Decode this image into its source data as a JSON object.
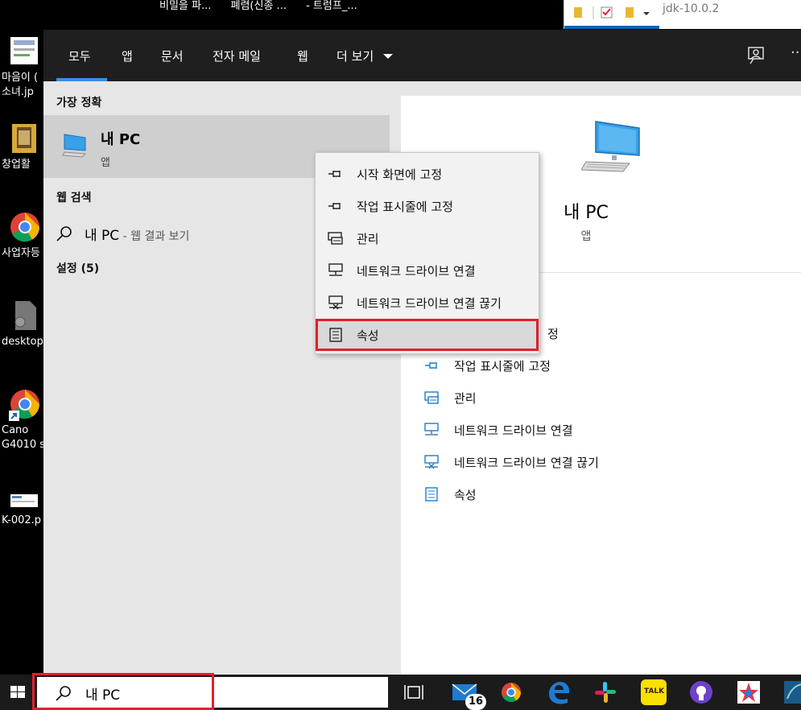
{
  "desktop": {
    "window_titles": [
      "비밀을 파...",
      "폐렴(신종 ...",
      "- 트럼프_..."
    ],
    "explorer_path": "jdk-10.0.2",
    "icons": [
      {
        "label_line1": "마음이 (",
        "label_line2": "소녀.jp"
      },
      {
        "label_line1": "창업활"
      },
      {
        "label_line1": "사업자등"
      },
      {
        "label_line1": "desktop"
      },
      {
        "label_line1": "Cano",
        "label_line2": "G4010 s"
      },
      {
        "label_line1": "K-002.p"
      }
    ]
  },
  "tabs": [
    "모두",
    "앱",
    "문서",
    "전자 메일",
    "웹",
    "더 보기"
  ],
  "left": {
    "best_match_header": "가장 정확",
    "best_item_title": "내 PC",
    "best_item_sub": "앱",
    "web_header": "웹 검색",
    "web_query": "내 PC",
    "web_suffix": " - 웹 결과 보기",
    "settings_header": "설정 (5)"
  },
  "right": {
    "title": "내 PC",
    "sub": "앱",
    "items": [
      "정",
      "작업 표시줄에 고정",
      "관리",
      "네트워크 드라이브 연결",
      "네트워크 드라이브 연결 끊기",
      "속성"
    ]
  },
  "context_menu": {
    "items": [
      "시작 화면에 고정",
      "작업 표시줄에 고정",
      "관리",
      "네트워크 드라이브 연결",
      "네트워크 드라이브 연결 끊기",
      "속성"
    ]
  },
  "taskbar": {
    "search_value": "내 PC",
    "mail_badge": "16",
    "kakao_label": "TALK"
  },
  "colors": {
    "highlight_red": "#e0202a",
    "accent_blue": "#3a8ee6",
    "icon_blue": "#1e7bd0"
  }
}
